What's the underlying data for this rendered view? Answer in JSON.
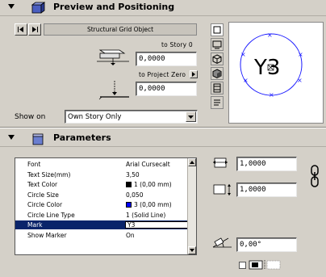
{
  "sections": {
    "preview": {
      "title": "Preview and Positioning"
    },
    "parameters": {
      "title": "Parameters"
    }
  },
  "preview": {
    "object_name": "Structural Grid Object",
    "to_story_label": "to Story 0",
    "story_value": "0,0000",
    "to_project_label": "to Project Zero",
    "project_value": "0,0000",
    "show_on_label": "Show on",
    "show_on_value": "Own Story Only",
    "symbol_text": "Y3"
  },
  "parameters_list": {
    "rows": [
      {
        "name": "Font",
        "value": "Arial Cursecalt"
      },
      {
        "name": "Text Size(mm)",
        "value": "3,50"
      },
      {
        "name": "Text Color",
        "value": "1 (0,00 mm)",
        "swatch": "#000000"
      },
      {
        "name": "Circle Size",
        "value": "0,050"
      },
      {
        "name": "Circle Color",
        "value": "3 (0,00 mm)",
        "swatch": "#0000ff"
      },
      {
        "name": "Circle Line Type",
        "value": "1 (Solid Line)"
      },
      {
        "name": "Mark",
        "value": "Y3"
      },
      {
        "name": "Show Marker",
        "value": "On"
      }
    ]
  },
  "dimensions": {
    "a_value": "1,0000",
    "b_value": "1,0000",
    "angle_value": "0,00°"
  },
  "colors": {
    "panel_bg": "#d4d0c8",
    "selection": "#0a246a",
    "circle": "#1a1aff"
  }
}
